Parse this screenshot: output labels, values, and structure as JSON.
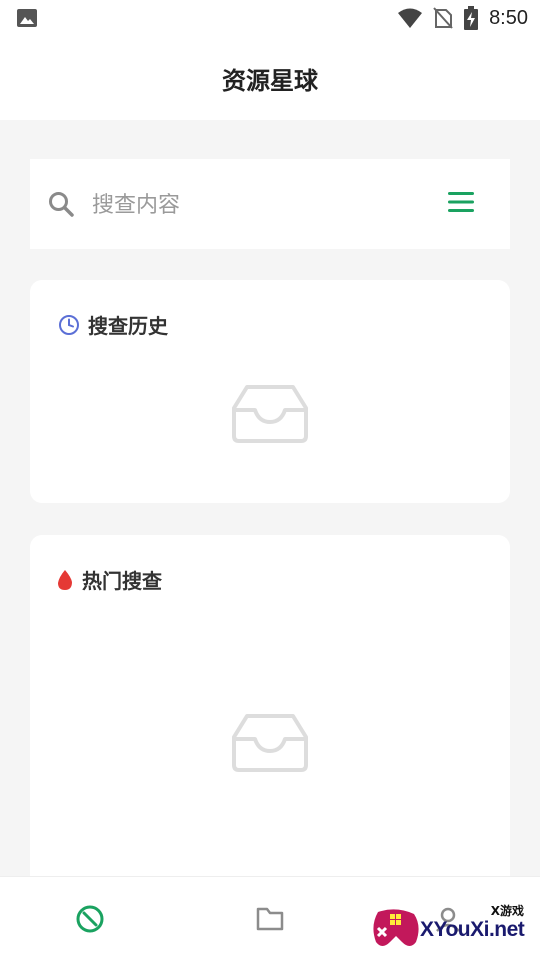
{
  "status_bar": {
    "time": "8:50",
    "icons": [
      "photo-icon",
      "wifi-icon",
      "no-sim-icon",
      "battery-charging-icon"
    ]
  },
  "app": {
    "title": "资源星球"
  },
  "search": {
    "placeholder": "搜查内容",
    "value": "",
    "menu_icon": "menu-icon",
    "accent_color": "#1aa260"
  },
  "history": {
    "label": "搜查历史",
    "icon": "clock-icon",
    "icon_color": "#5b6fd6",
    "items": []
  },
  "hot": {
    "label": "热门搜查",
    "icon": "flame-icon",
    "icon_color": "#e53935",
    "items": []
  },
  "bottom_nav": {
    "items": [
      {
        "icon": "home-icon",
        "active": true
      },
      {
        "icon": "folder-icon",
        "active": false
      },
      {
        "icon": "profile-icon",
        "active": false
      }
    ]
  },
  "watermark": {
    "small_text": "X游戏",
    "big_text": "XYouXi.net"
  }
}
